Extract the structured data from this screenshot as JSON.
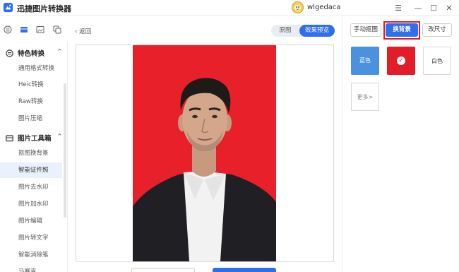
{
  "app": {
    "title": "迅捷图片转换器",
    "username": "wlgedaca"
  },
  "window": {
    "min": "—",
    "restore": "☐",
    "close": "✕",
    "menu": "☰"
  },
  "sidebar": {
    "groups": [
      {
        "label": "特色转换",
        "items": [
          "通用格式转换",
          "Heic转换",
          "Raw转换",
          "图片压缩"
        ]
      },
      {
        "label": "图片工具箱",
        "items": [
          "抠图换背景",
          "智能证件照",
          "图片去水印",
          "图片加水印",
          "图片编辑",
          "图片转文字",
          "智能消除笔",
          "马赛克"
        ]
      }
    ],
    "active_item": "智能证件照"
  },
  "main": {
    "back_label": "返回",
    "view_toggle": {
      "original": "原图",
      "preview": "效果预览",
      "selected": "效果预览"
    }
  },
  "right_panel": {
    "tabs": [
      "手动抠图",
      "换背景",
      "改尺寸"
    ],
    "active_tab": "换背景",
    "colors": [
      {
        "label": "蓝色",
        "hex": "#4a91e0"
      },
      {
        "label": "",
        "hex": "#e31d27",
        "selected": true
      },
      {
        "label": "白色",
        "hex": "#ffffff"
      }
    ],
    "more_label": "更多>"
  },
  "colors": {
    "accent": "#2f6fec",
    "highlight": "#e31d27",
    "photo_bg": "#e8202a"
  }
}
